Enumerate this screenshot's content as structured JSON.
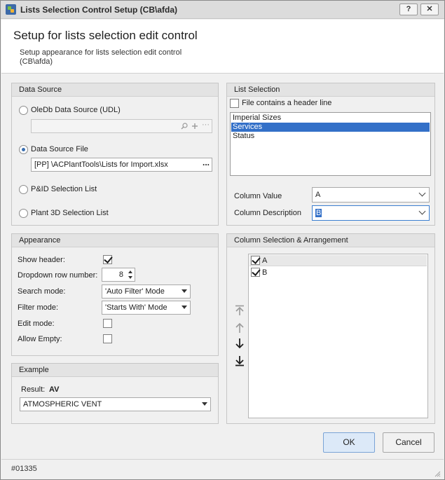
{
  "window": {
    "title": "Lists Selection Control Setup (CB\\afda)",
    "help_label": "?",
    "close_label": "✕"
  },
  "header": {
    "title": "Setup for lists selection edit control",
    "subtitle": "Setup appearance for lists selection edit control (CB\\afda)"
  },
  "data_source": {
    "title": "Data Source",
    "oledb_label": "OleDb Data Source (UDL)",
    "oledb_value": "",
    "file_label": "Data Source File",
    "file_value": "[PP] \\ACPlantTools\\Lists for Import.xlsx",
    "ellipsis": "...",
    "pid_label": "P&ID Selection List",
    "plant3d_label": "Plant 3D Selection List",
    "selected": "file"
  },
  "list_selection": {
    "title": "List Selection",
    "header_line_label": "File contains a header line",
    "header_line_checked": false,
    "lists": [
      "Imperial Sizes",
      "Services",
      "Status"
    ],
    "selected_list": "Services",
    "column_value_label": "Column Value",
    "column_value": "A",
    "column_description_label": "Column Description",
    "column_description": "B"
  },
  "appearance": {
    "title": "Appearance",
    "show_header_label": "Show header:",
    "show_header": true,
    "dropdown_rows_label": "Dropdown row number:",
    "dropdown_rows": "8",
    "search_mode_label": "Search mode:",
    "search_mode": "'Auto Filter' Mode",
    "filter_mode_label": "Filter mode:",
    "filter_mode": "'Starts With' Mode",
    "edit_mode_label": "Edit mode:",
    "edit_mode": false,
    "allow_empty_label": "Allow Empty:",
    "allow_empty": false
  },
  "column_arrangement": {
    "title": "Column Selection & Arrangement",
    "columns": [
      {
        "name": "A",
        "checked": true
      },
      {
        "name": "B",
        "checked": true
      }
    ]
  },
  "example": {
    "title": "Example",
    "result_label": "Result:",
    "result_value": "AV",
    "combo_value": "ATMOSPHERIC VENT"
  },
  "buttons": {
    "ok": "OK",
    "cancel": "Cancel"
  },
  "status": {
    "id": "#01335"
  },
  "colors": {
    "selection": "#3370c8",
    "ok_button": "#dce9f8",
    "accent": "#3a6fb0"
  }
}
